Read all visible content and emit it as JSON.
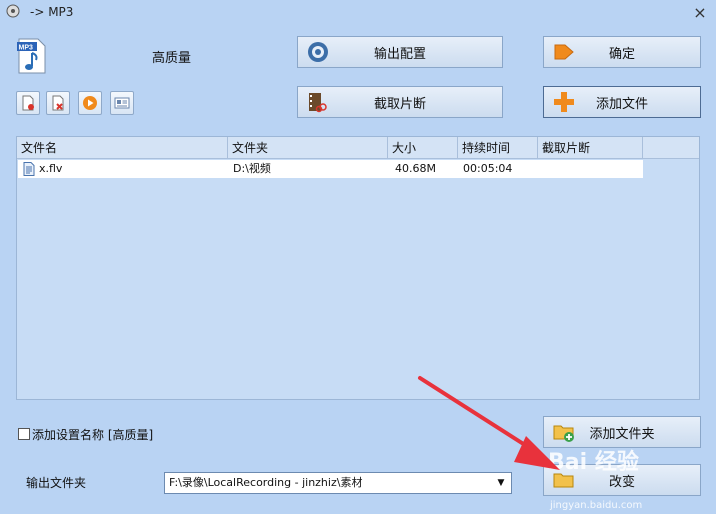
{
  "window": {
    "title": "-> MP3",
    "close_glyph": "×"
  },
  "preset": {
    "logo_text": "MP3",
    "name": "高质量"
  },
  "buttons": {
    "output_config": "输出配置",
    "confirm": "确定",
    "clip": "截取片断",
    "add_file": "添加文件",
    "add_folder": "添加文件夹",
    "change": "改变"
  },
  "file_list": {
    "columns": [
      "文件名",
      "文件夹",
      "大小",
      "持续时间",
      "截取片断"
    ],
    "rows": [
      {
        "name": "x.flv",
        "folder": "D:\\视频",
        "size": "40.68M",
        "duration": "00:05:04",
        "clip": ""
      }
    ]
  },
  "bottom": {
    "add_setting_label": "添加设置名称 [高质量]",
    "output_folder_label": "输出文件夹",
    "output_folder_value": "F:\\录像\\LocalRecording - jinzhiz\\素材"
  },
  "watermark": {
    "main": "Bai 经验",
    "sub": "jingyan.baidu.com"
  },
  "colors": {
    "background": "#b9d3f3",
    "annotation_arrow": "#e8323c"
  },
  "icons": {
    "toolbar": [
      "new-file-icon",
      "remove-file-icon",
      "play-icon",
      "info-icon"
    ]
  }
}
